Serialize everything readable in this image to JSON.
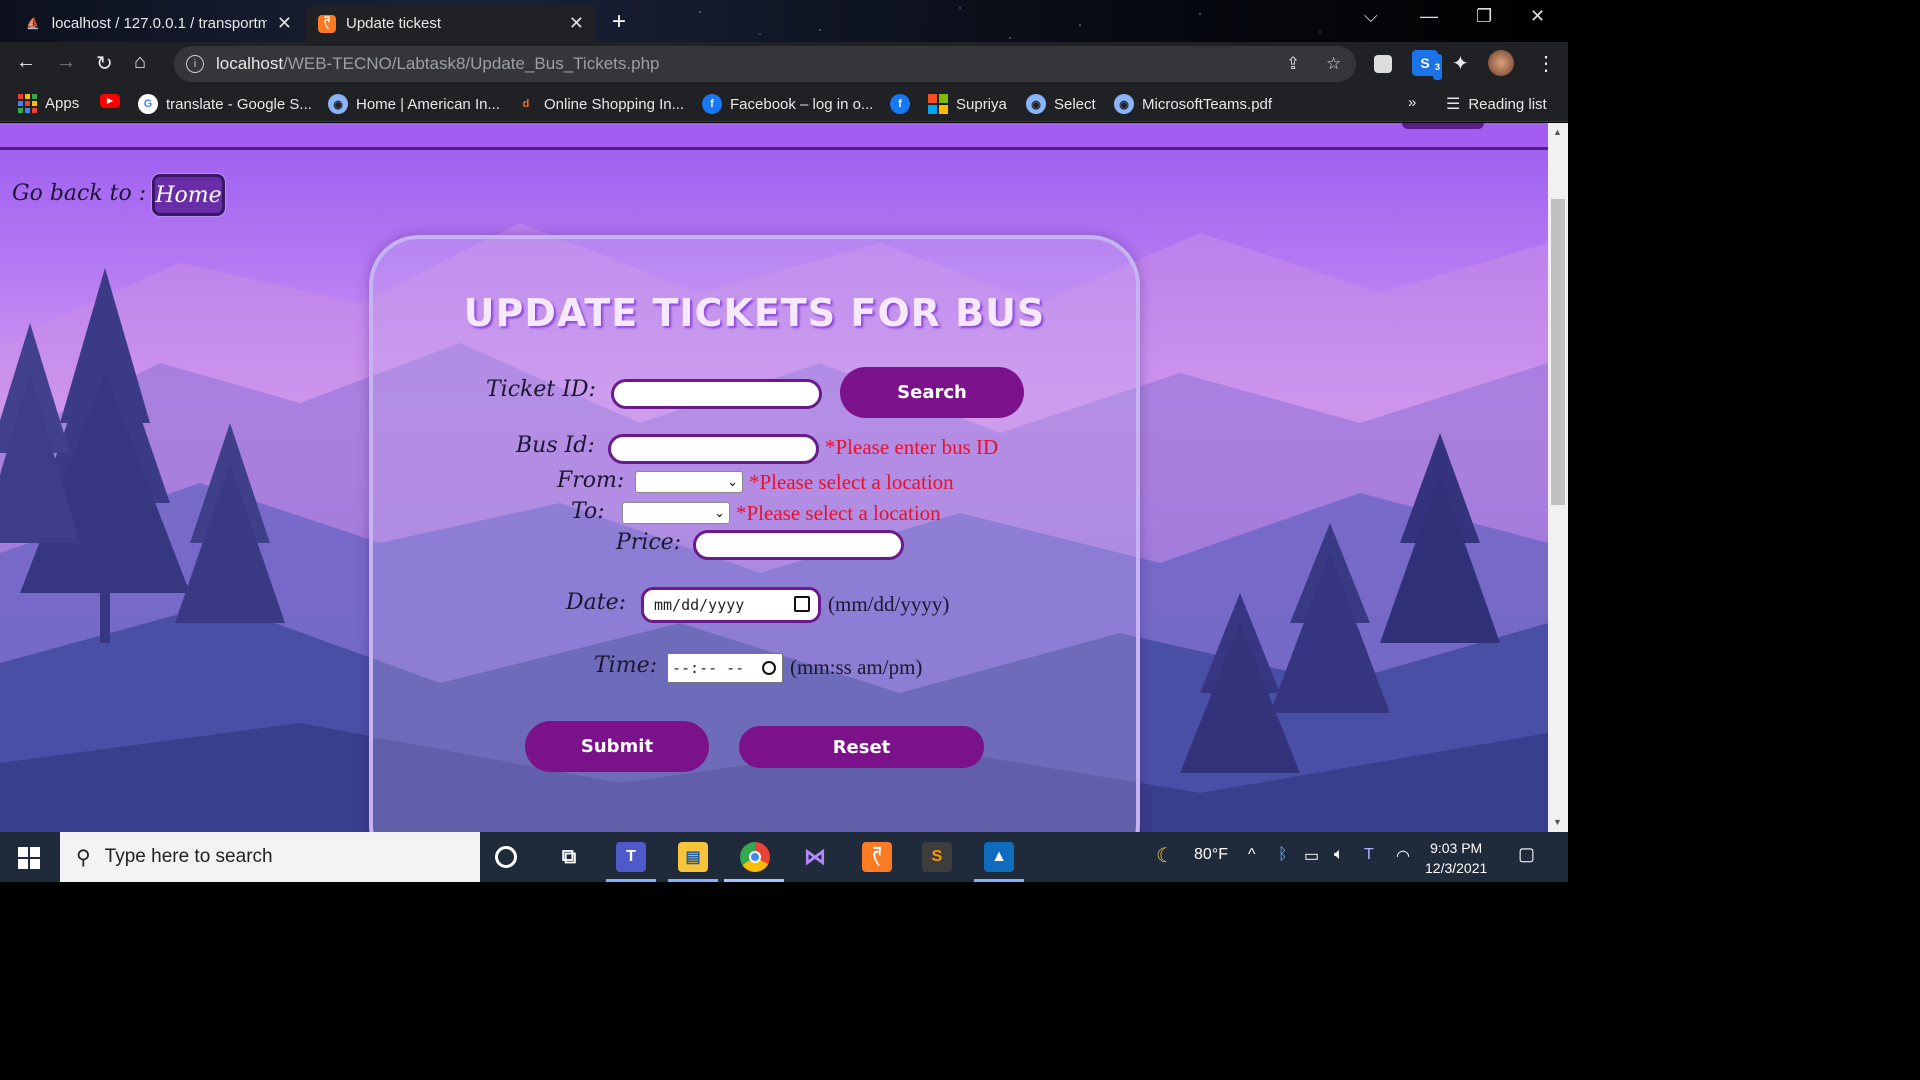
{
  "browser": {
    "tabs": [
      {
        "title": "localhost / 127.0.0.1 / transportm",
        "active": false
      },
      {
        "title": "Update tickest",
        "active": true
      }
    ],
    "url_host": "localhost",
    "url_path": "/WEB-TECNO/Labtask8/Update_Bus_Tickets.php",
    "extension_badge": "3",
    "bookmarks": [
      "Apps",
      "translate - Google S...",
      "Home | American In...",
      "Online Shopping In...",
      "Facebook – log in o...",
      "Supriya",
      "Select",
      "MicrosoftTeams.pdf"
    ],
    "bookmarks_overflow": "»",
    "reading_list": "Reading list"
  },
  "page": {
    "go_back_label": "Go back to :",
    "home_button": "Home",
    "form_title": "UPDATE TICKETS FOR BUS",
    "ticket_id_label": "Ticket ID:",
    "search_button": "Search",
    "bus_id_label": "Bus Id:",
    "bus_id_error": "*Please enter bus ID",
    "from_label": "From:",
    "from_error": "*Please select a location",
    "to_label": "To:",
    "to_error": "*Please select a location",
    "price_label": "Price:",
    "date_label": "Date:",
    "date_placeholder": "mm/dd/yyyy",
    "date_hint": "(mm/dd/yyyy)",
    "time_label": "Time:",
    "time_placeholder": "--:-- --",
    "time_hint": "(mm:ss am/pm)",
    "submit_button": "Submit",
    "reset_button": "Reset"
  },
  "taskbar": {
    "search_placeholder": "Type here to search",
    "weather": "80°F",
    "time": "9:03 PM",
    "date": "12/3/2021"
  }
}
